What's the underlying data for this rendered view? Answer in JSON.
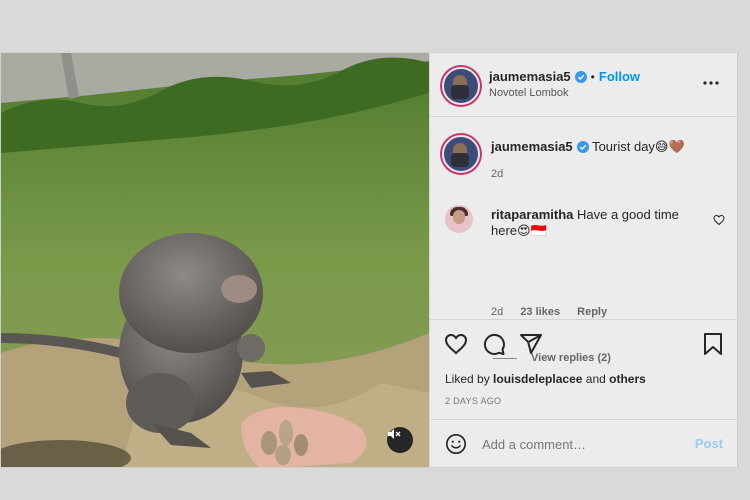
{
  "post": {
    "author": "jaumemasia5",
    "follow_label": "Follow",
    "separator": "•",
    "location": "Novotel Lombok",
    "caption_text": "Tourist day😅🤎",
    "caption_time": "2d"
  },
  "comment": {
    "username": "ritaparamitha",
    "text": "Have a good time here😍🇮🇩",
    "time": "2d",
    "likes": "23 likes",
    "reply_label": "Reply",
    "view_replies": "View replies (2)"
  },
  "engagement": {
    "liked_prefix": "Liked by",
    "liked_user": "louisdeleplacee",
    "liked_and": "and",
    "liked_others": "others",
    "date": "2 DAYS AGO"
  },
  "composer": {
    "placeholder": "Add a comment…",
    "post_label": "Post"
  },
  "icons": {
    "verified": "verified-badge-icon",
    "more": "more-options-icon",
    "like": "heart-icon",
    "comment": "comment-icon",
    "share": "share-icon",
    "save": "bookmark-icon",
    "emoji": "emoji-icon",
    "mute": "muted-speaker-icon"
  },
  "colors": {
    "accent": "#0095f6",
    "verified": "#3897f0",
    "post_disabled": "#9cc9ef"
  }
}
